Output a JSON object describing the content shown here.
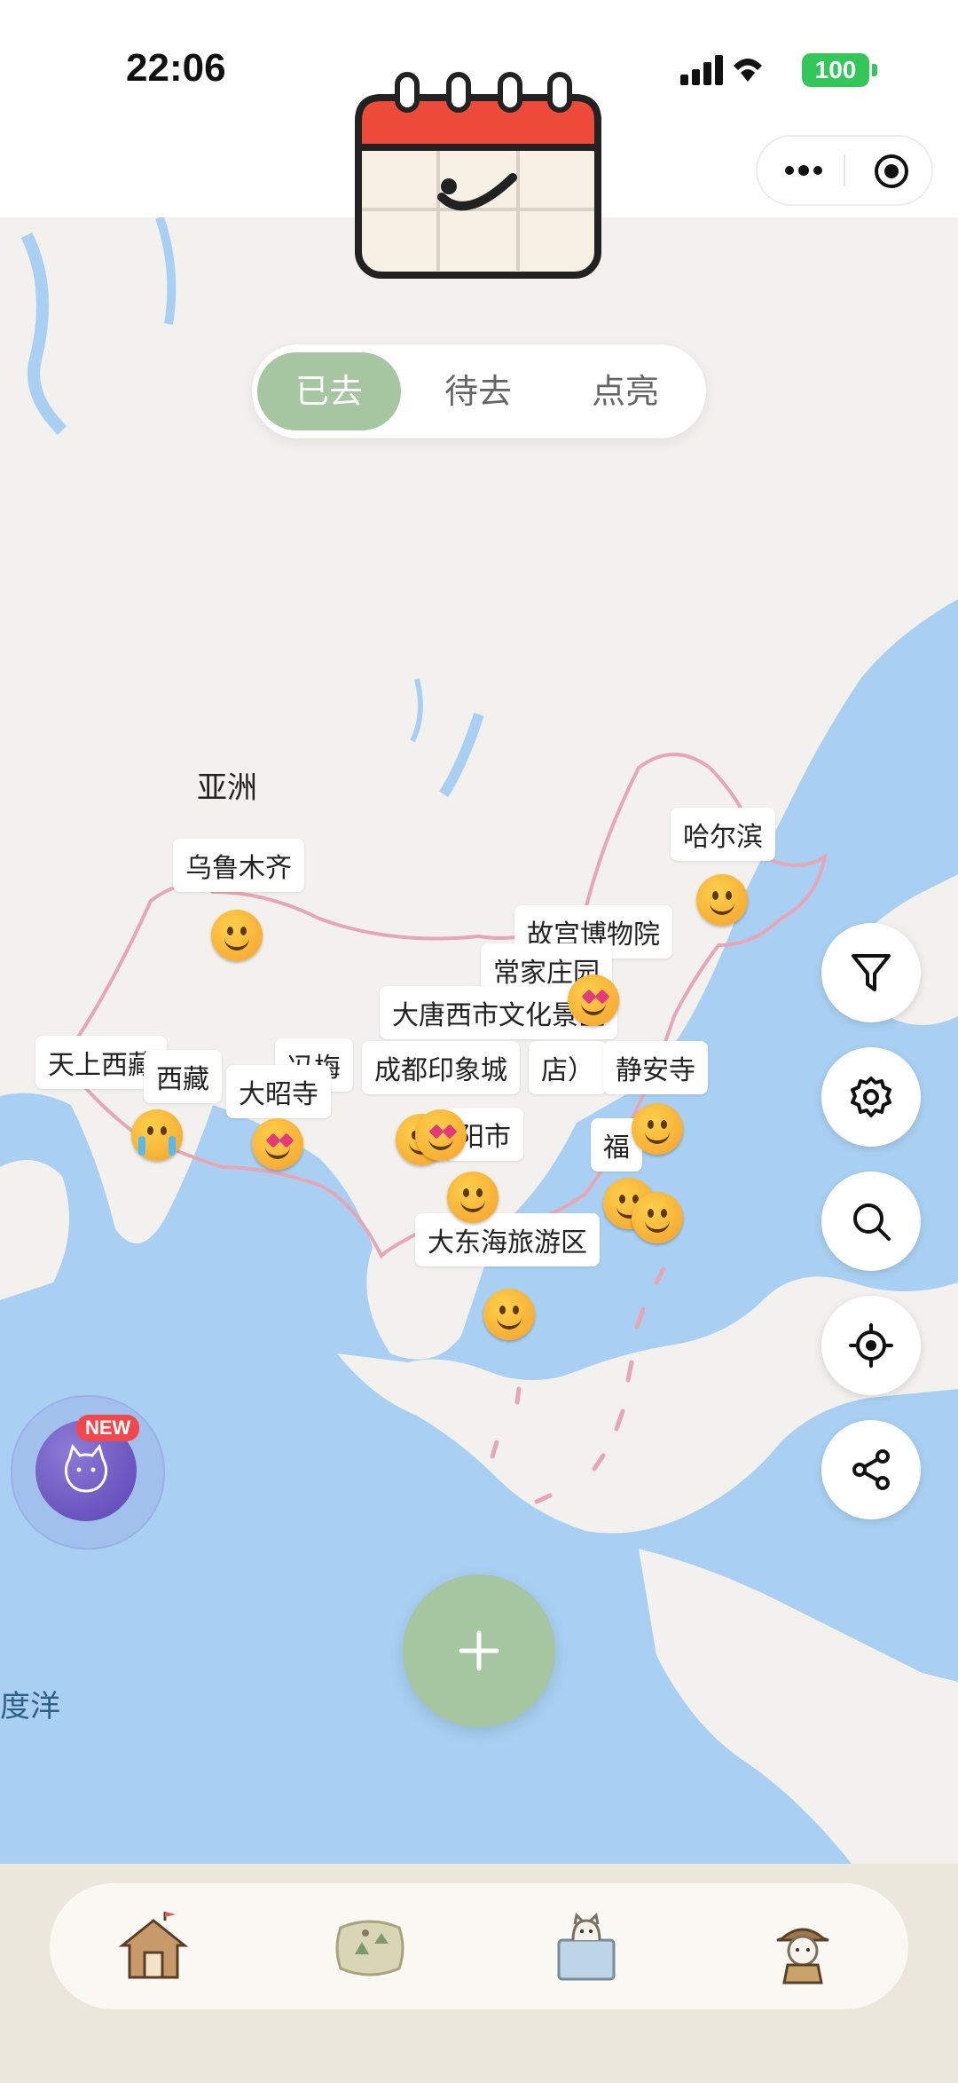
{
  "status_bar": {
    "time": "22:06",
    "battery": "100"
  },
  "segment": {
    "items": [
      "已去",
      "待去",
      "点亮"
    ],
    "active_index": 0
  },
  "map": {
    "continent_label": "亚洲",
    "ocean_label": "度洋",
    "places": {
      "wulumuqi": "乌鲁木齐",
      "haerbin": "哈尔滨",
      "gugong": "故宫博物院",
      "changjia": "常家庄园",
      "datang": "大唐西市文化景区",
      "tianshang": "天上西藏",
      "xizang": "西藏",
      "dazhao": "大昭寺",
      "feng": "冯梅",
      "chengdu": "成都印象城",
      "dian": "店）",
      "jingan": "静安寺",
      "yang": "阳市",
      "fu": "福",
      "dadonghai": "大东海旅游区"
    }
  },
  "new_badge": "NEW",
  "colors": {
    "accent_green": "#a6c6a1",
    "ocean": "#a9d0f2",
    "land": "#f2f1ee",
    "route": "#e7a6b6",
    "battery": "#33c759"
  }
}
